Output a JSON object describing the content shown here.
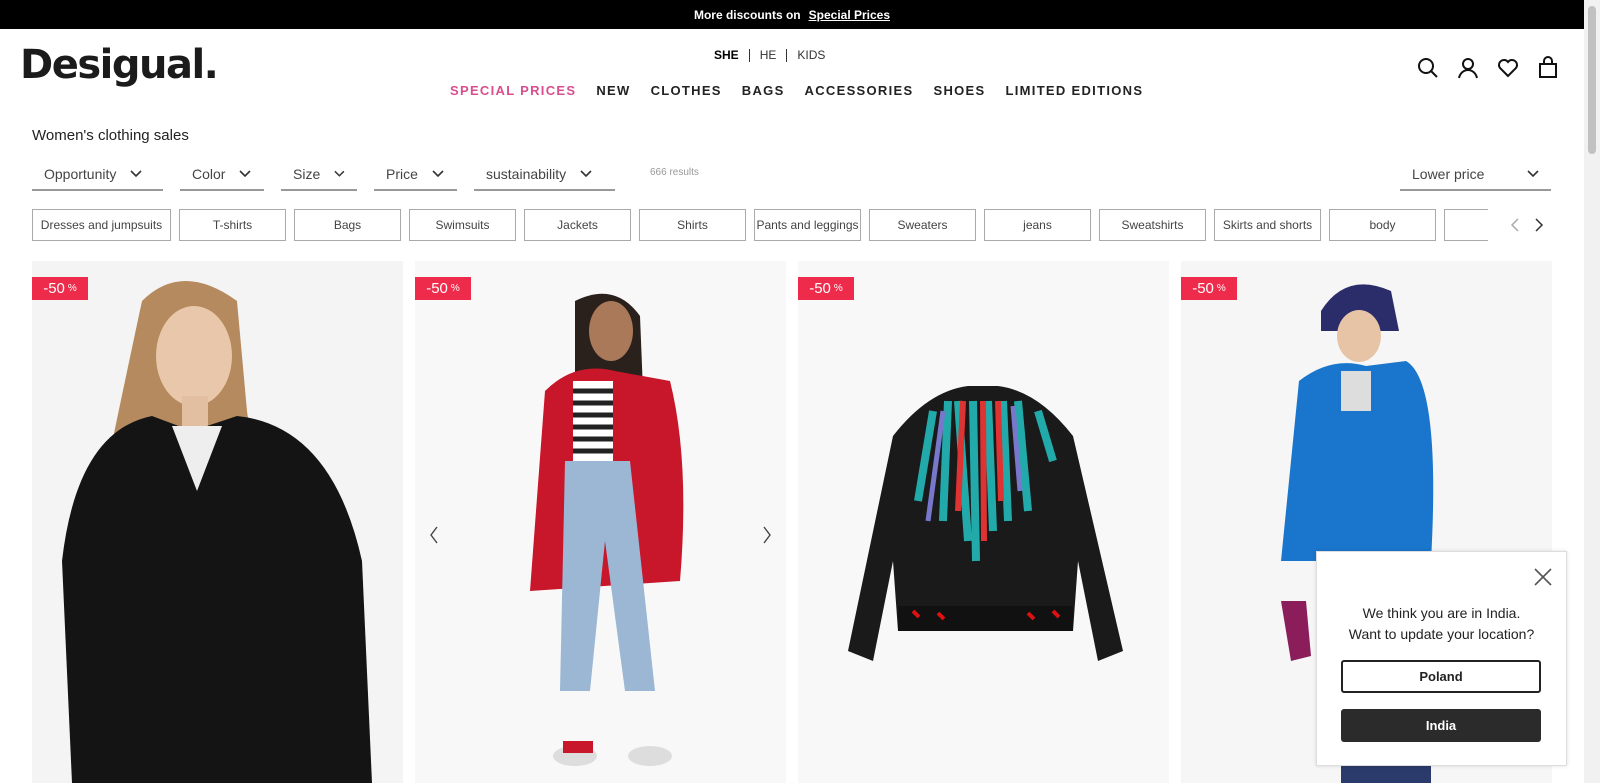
{
  "topbar": {
    "text": "More discounts on",
    "link": "Special Prices"
  },
  "logo": "Desigual.",
  "gender_nav": [
    "SHE",
    "HE",
    "KIDS"
  ],
  "main_nav": [
    "SPECIAL PRICES",
    "NEW",
    "CLOTHES",
    "BAGS",
    "ACCESSORIES",
    "SHOES",
    "LIMITED EDITIONS"
  ],
  "header_icons": [
    "search-icon",
    "account-icon",
    "wishlist-icon",
    "bag-icon"
  ],
  "page_title": "Women's clothing sales",
  "filters": [
    "Opportunity",
    "Color",
    "Size",
    "Price",
    "sustainability"
  ],
  "results": "666 results",
  "sort": "Lower price",
  "categories": [
    "Dresses and jumpsuits",
    "T-shirts",
    "Bags",
    "Swimsuits",
    "Jackets",
    "Shirts",
    "Pants and leggings",
    "Sweaters",
    "jeans",
    "Sweatshirts",
    "Skirts and shorts",
    "body",
    ""
  ],
  "products": [
    {
      "discount": "-50",
      "unit": "%"
    },
    {
      "discount": "-50",
      "unit": "%"
    },
    {
      "discount": "-50",
      "unit": "%"
    },
    {
      "discount": "-50",
      "unit": "%"
    }
  ],
  "location_popup": {
    "line1": "We think you are in India.",
    "line2": "Want to update your location?",
    "option1": "Poland",
    "option2": "India"
  },
  "colors": {
    "accent_pink": "#d94e8f",
    "badge_red": "#ee2b4a"
  }
}
